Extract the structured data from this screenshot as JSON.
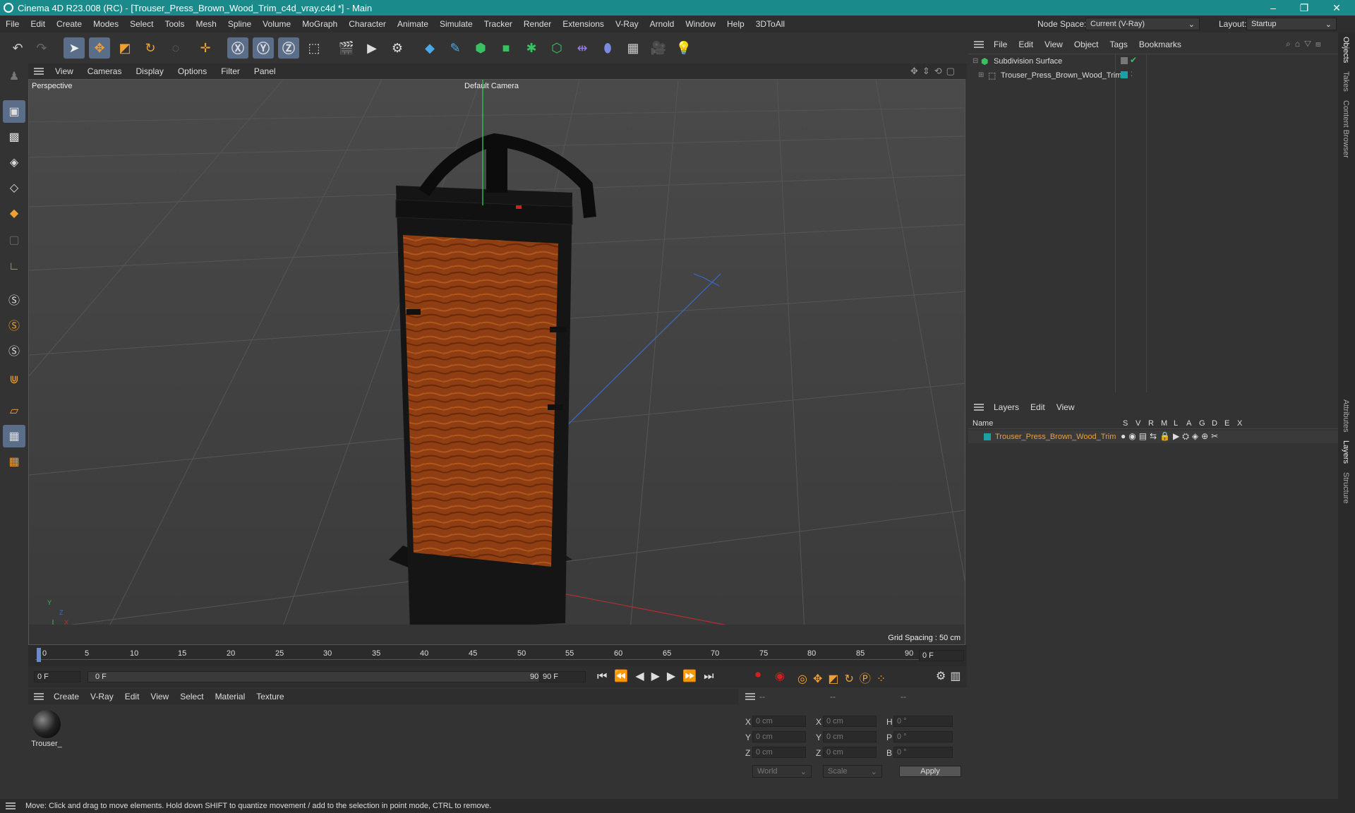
{
  "window": {
    "title": "Cinema 4D R23.008 (RC) - [Trouser_Press_Brown_Wood_Trim_c4d_vray.c4d *] - Main",
    "minimize": "–",
    "maximize": "❐",
    "close": "✕"
  },
  "menu": [
    "File",
    "Edit",
    "Create",
    "Modes",
    "Select",
    "Tools",
    "Mesh",
    "Spline",
    "Volume",
    "MoGraph",
    "Character",
    "Animate",
    "Simulate",
    "Tracker",
    "Render",
    "Extensions",
    "V-Ray",
    "Arnold",
    "Window",
    "Help",
    "3DToAll"
  ],
  "node_space": {
    "label": "Node Space:",
    "value": "Current (V-Ray)"
  },
  "layout": {
    "label": "Layout:",
    "value": "Startup"
  },
  "viewport": {
    "menu": [
      "View",
      "Cameras",
      "Display",
      "Options",
      "Filter",
      "Panel"
    ],
    "label": "Perspective",
    "camera": "Default Camera",
    "grid_spacing": "Grid Spacing : 50 cm",
    "axis_y": "Y",
    "axis_z": "Z",
    "axis_x": "X"
  },
  "timeline": {
    "ticks": [
      "0",
      "5",
      "10",
      "15",
      "20",
      "25",
      "30",
      "35",
      "40",
      "45",
      "50",
      "55",
      "60",
      "65",
      "70",
      "75",
      "80",
      "85",
      "90"
    ],
    "current": "0 F"
  },
  "playback": {
    "start": "0 F",
    "range_start": "0 F",
    "range_end": "90 F",
    "end": "90 F"
  },
  "materials": {
    "menu": [
      "Create",
      "V-Ray",
      "Edit",
      "View",
      "Select",
      "Material",
      "Texture"
    ],
    "items": [
      {
        "name": "Trouser_"
      }
    ]
  },
  "coords": {
    "headers": [
      "--",
      "--",
      "--"
    ],
    "rows": [
      {
        "a": "X",
        "av": "0 cm",
        "b": "X",
        "bv": "0 cm",
        "c": "H",
        "cv": "0 °"
      },
      {
        "a": "Y",
        "av": "0 cm",
        "b": "Y",
        "bv": "0 cm",
        "c": "P",
        "cv": "0 °"
      },
      {
        "a": "Z",
        "av": "0 cm",
        "b": "Z",
        "bv": "0 cm",
        "c": "B",
        "cv": "0 °"
      }
    ],
    "world": "World",
    "scale": "Scale",
    "apply": "Apply"
  },
  "objects": {
    "menu": [
      "File",
      "Edit",
      "View",
      "Object",
      "Tags",
      "Bookmarks"
    ],
    "items": [
      {
        "name": "Subdivision Surface"
      },
      {
        "name": "Trouser_Press_Brown_Wood_Trim"
      }
    ]
  },
  "layers": {
    "menu": [
      "Layers",
      "Edit",
      "View"
    ],
    "col_name": "Name",
    "cols": [
      "S",
      "V",
      "R",
      "M",
      "L",
      "A",
      "G",
      "D",
      "E",
      "X"
    ],
    "items": [
      {
        "name": "Trouser_Press_Brown_Wood_Trim"
      }
    ]
  },
  "right_tabs": [
    "Objects",
    "Takes",
    "Content Browser",
    "Attributes",
    "Layers",
    "Structure"
  ],
  "status": "Move: Click and drag to move elements. Hold down SHIFT to quantize movement / add to the selection in point mode, CTRL to remove.",
  "colors": {
    "accent": "#1a8a8a",
    "layer_teal": "#1aa0a8",
    "layer_name": "#e8a040",
    "wood": "#8a3a10"
  }
}
